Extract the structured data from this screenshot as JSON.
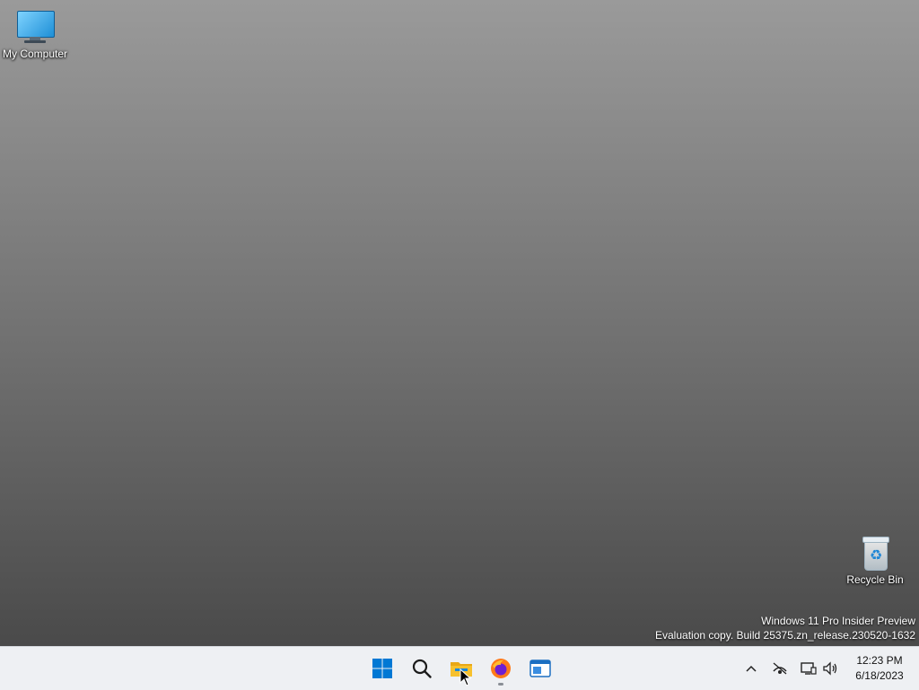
{
  "desktop": {
    "wallpaper_note": "A plain neutral gradient stands in for the wallpaper photograph.",
    "icons": [
      {
        "label": "My Computer",
        "icon": "computer-icon"
      },
      {
        "label": "Recycle Bin",
        "icon": "recycle-bin-icon"
      }
    ],
    "watermark": {
      "line1": "Windows 11 Pro Insider Preview",
      "line2": "Evaluation copy. Build 25375.zn_release.230520-1632"
    }
  },
  "taskbar": {
    "pinned": [
      {
        "name": "start",
        "icon": "windows-logo-icon",
        "active": false
      },
      {
        "name": "search",
        "icon": "search-icon",
        "active": false
      },
      {
        "name": "file-explorer",
        "icon": "folder-icon",
        "active": false
      },
      {
        "name": "firefox",
        "icon": "firefox-icon",
        "active": true
      },
      {
        "name": "app",
        "icon": "window-app-icon",
        "active": false
      }
    ],
    "tray": {
      "icons": [
        "chevron-up-icon",
        "network-icon",
        "display-icon",
        "volume-icon"
      ],
      "time": "12:23 PM",
      "date": "6/18/2023"
    }
  },
  "colors": {
    "taskbar_bg": "#eef0f3",
    "windows_blue": "#0078d4",
    "folder_yellow": "#f7c12e"
  }
}
